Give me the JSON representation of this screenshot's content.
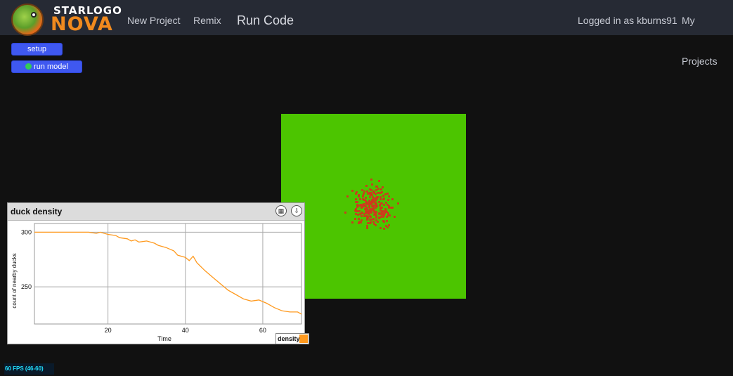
{
  "header": {
    "logo_top": "STARLOGO",
    "logo_bottom": "NOVA",
    "nav": {
      "new_project": "New Project",
      "remix": "Remix",
      "run_code": "Run Code"
    },
    "logged_in": "Logged in as kburns91",
    "my_projects": "My Projects"
  },
  "controls": {
    "setup": "setup",
    "run_model": "run model"
  },
  "world": {
    "background": "#4cc500",
    "agent_color": "#cc3b1c"
  },
  "chart_panel": {
    "title": "duck density",
    "icons": [
      "table-icon",
      "download-icon"
    ],
    "legend_label": "density",
    "legend_color": "#ff9a1f"
  },
  "chart_data": {
    "type": "line",
    "title": "duck density",
    "xlabel": "Time",
    "ylabel": "count of nearby ducks",
    "xlim": [
      1,
      70
    ],
    "ylim": [
      216,
      308
    ],
    "xticks": [
      20,
      40,
      60
    ],
    "yticks": [
      250,
      300
    ],
    "grid": true,
    "legend": "bottom-right",
    "series": [
      {
        "name": "density",
        "color": "#ff9a1f",
        "x": [
          1,
          5,
          10,
          15,
          17,
          18,
          20,
          22,
          23,
          25,
          26,
          27,
          28,
          30,
          32,
          33,
          35,
          37,
          38,
          40,
          41,
          42,
          43,
          45,
          47,
          49,
          51,
          53,
          55,
          57,
          59,
          61,
          63,
          65,
          67,
          69,
          70
        ],
        "values": [
          300,
          300,
          300,
          300,
          299,
          300,
          298,
          297,
          295,
          294,
          292,
          293,
          291,
          292,
          290,
          288,
          286,
          283,
          279,
          277,
          274,
          278,
          272,
          265,
          259,
          253,
          247,
          243,
          239,
          237,
          238,
          235,
          231,
          228,
          227,
          227,
          225
        ]
      }
    ]
  },
  "status": {
    "fps": "60 FPS (46-60)"
  }
}
